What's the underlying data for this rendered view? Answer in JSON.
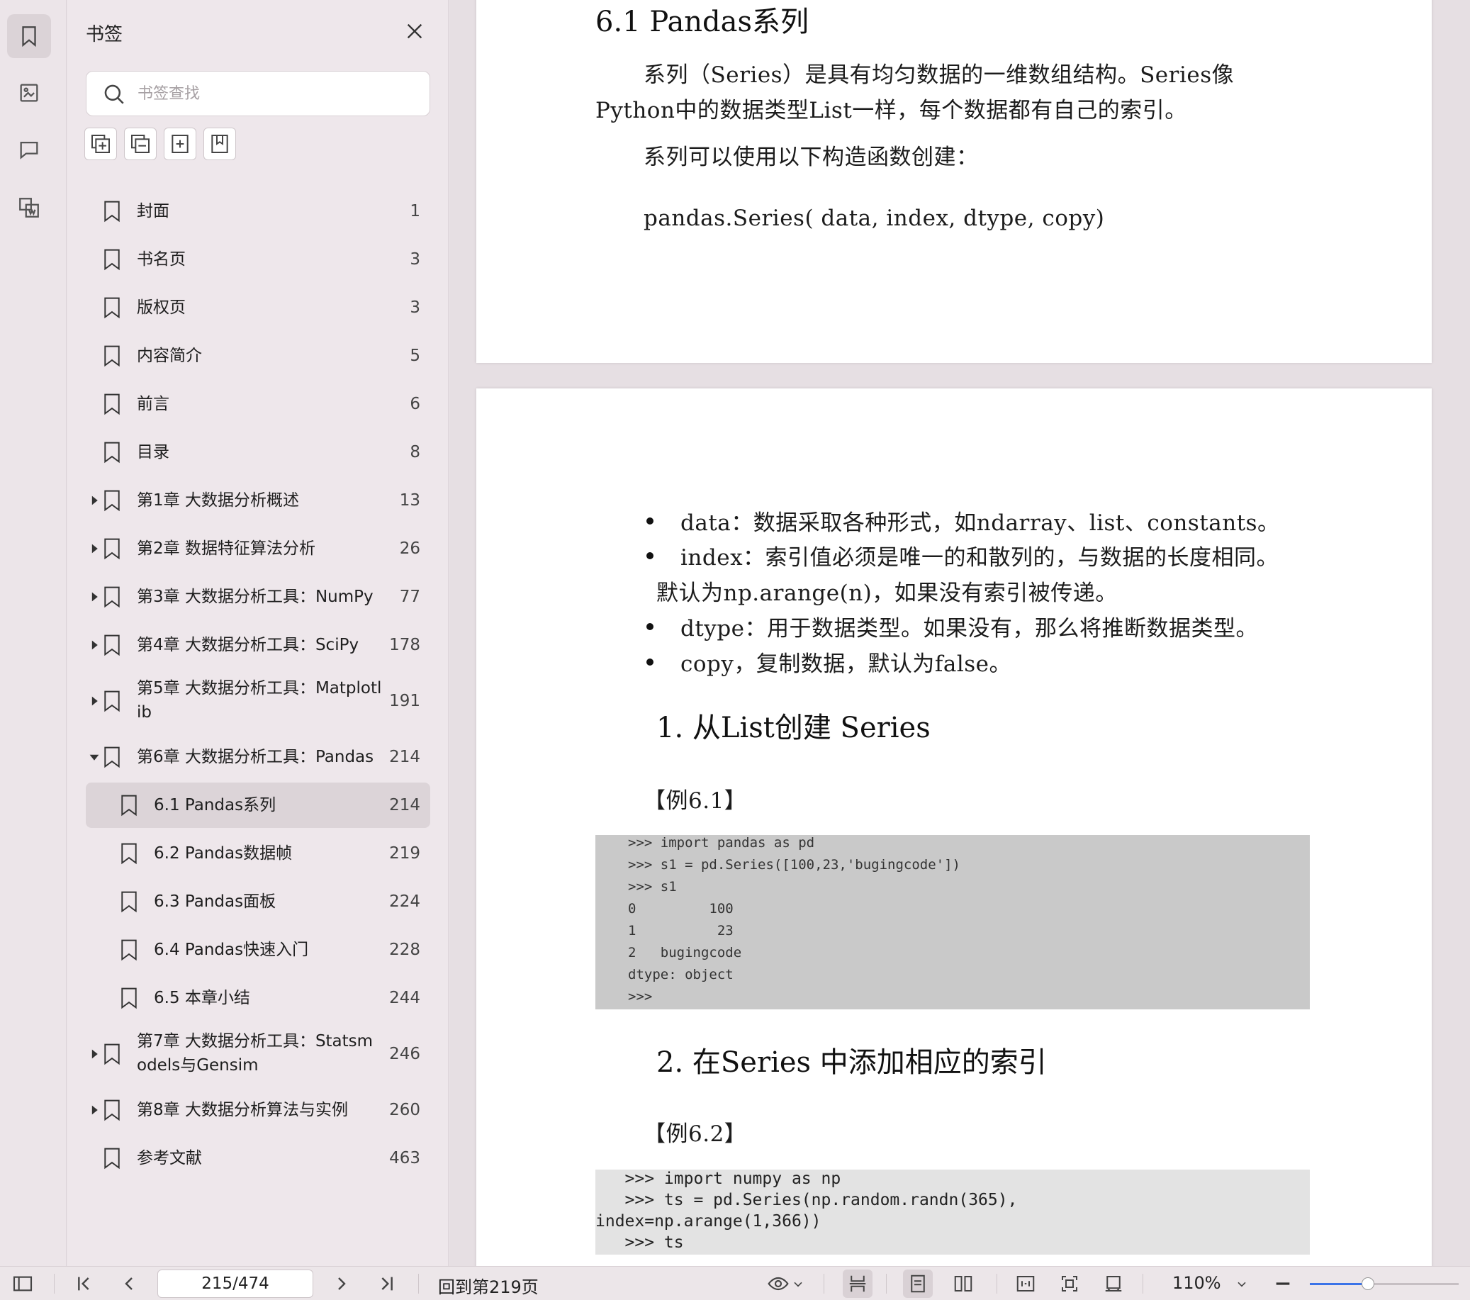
{
  "sidebar_rail": {
    "items": [
      {
        "name": "bookmark-icon",
        "active": true
      },
      {
        "name": "thumbnail-icon",
        "active": false
      },
      {
        "name": "comment-icon",
        "active": false
      },
      {
        "name": "extract-icon",
        "active": false
      }
    ]
  },
  "bookmark_panel": {
    "title": "书签",
    "search_placeholder": "书签查找",
    "tools": [
      "add-bookmark-icon",
      "collapse-bookmark-icon",
      "insert-bookmark-icon",
      "ribbon-bookmark-icon"
    ],
    "items": [
      {
        "label": "封面",
        "page": "1",
        "level": 0,
        "expand": "none",
        "selected": false
      },
      {
        "label": "书名页",
        "page": "3",
        "level": 0,
        "expand": "none",
        "selected": false
      },
      {
        "label": "版权页",
        "page": "3",
        "level": 0,
        "expand": "none",
        "selected": false
      },
      {
        "label": "内容简介",
        "page": "5",
        "level": 0,
        "expand": "none",
        "selected": false
      },
      {
        "label": "前言",
        "page": "6",
        "level": 0,
        "expand": "none",
        "selected": false
      },
      {
        "label": "目录",
        "page": "8",
        "level": 0,
        "expand": "none",
        "selected": false
      },
      {
        "label": "第1章 大数据分析概述",
        "page": "13",
        "level": 0,
        "expand": "collapsed",
        "selected": false
      },
      {
        "label": "第2章 数据特征算法分析",
        "page": "26",
        "level": 0,
        "expand": "collapsed",
        "selected": false
      },
      {
        "label": "第3章 大数据分析工具：NumPy",
        "page": "77",
        "level": 0,
        "expand": "collapsed",
        "selected": false
      },
      {
        "label": "第4章 大数据分析工具：SciPy",
        "page": "178",
        "level": 0,
        "expand": "collapsed",
        "selected": false
      },
      {
        "label": "第5章 大数据分析工具：Matplotl",
        "label2": "ib",
        "page": "191",
        "level": 0,
        "expand": "collapsed",
        "selected": false
      },
      {
        "label": "第6章 大数据分析工具：Pandas",
        "page": "214",
        "level": 0,
        "expand": "expanded",
        "selected": false
      },
      {
        "label": "6.1 Pandas系列",
        "page": "214",
        "level": 1,
        "expand": "none",
        "selected": true
      },
      {
        "label": "6.2 Pandas数据帧",
        "page": "219",
        "level": 1,
        "expand": "none",
        "selected": false
      },
      {
        "label": "6.3 Pandas面板",
        "page": "224",
        "level": 1,
        "expand": "none",
        "selected": false
      },
      {
        "label": "6.4 Pandas快速入门",
        "page": "228",
        "level": 1,
        "expand": "none",
        "selected": false
      },
      {
        "label": "6.5 本章小结",
        "page": "244",
        "level": 1,
        "expand": "none",
        "selected": false
      },
      {
        "label": "第7章 大数据分析工具：Statsm",
        "label2": "odels与Gensim",
        "page": "246",
        "level": 0,
        "expand": "collapsed",
        "selected": false
      },
      {
        "label": "第8章 大数据分析算法与实例",
        "page": "260",
        "level": 0,
        "expand": "collapsed",
        "selected": false
      },
      {
        "label": "参考文献",
        "page": "463",
        "level": 0,
        "expand": "none",
        "selected": false
      }
    ]
  },
  "document": {
    "page1": {
      "heading": "6.1  Pandas系列",
      "para1_line1": "系列（Series）是具有均匀数据的一维数组结构。Series像",
      "para1_line2": "Python中的数据类型List一样，每个数据都有自己的索引。",
      "para2": "系列可以使用以下构造函数创建：",
      "constructor": "pandas.Series( data, index, dtype, copy)"
    },
    "page2": {
      "bullets": [
        "data：数据采取各种形式，如ndarray、list、constants。",
        "index：索引值必须是唯一的和散列的，与数据的长度相同。",
        "dtype：用于数据类型。如果没有，那么将推断数据类型。",
        "copy，复制数据，默认为false。"
      ],
      "bullet2_cont": "默认为np.arange(n)，如果没有索引被传递。",
      "section1": "1. 从List创建 Series",
      "example1": "【例6.1】",
      "code1": [
        ">>> import pandas as pd",
        ">>> s1 = pd.Series([100,23,'bugingcode'])",
        ">>> s1",
        "0         100",
        "1          23",
        "2   bugingcode",
        "dtype: object",
        ">>>"
      ],
      "section2": "2. 在Series 中添加相应的索引",
      "example2": "【例6.2】",
      "code2": [
        "   >>> import numpy as np",
        "   >>> ts = pd.Series(np.random.randn(365),",
        "index=np.arange(1,366))",
        "   >>> ts"
      ]
    }
  },
  "statusbar": {
    "page_value": "215/474",
    "goto_label": "回到第219页",
    "zoom": "110%",
    "zoom_fraction": 0.39
  }
}
